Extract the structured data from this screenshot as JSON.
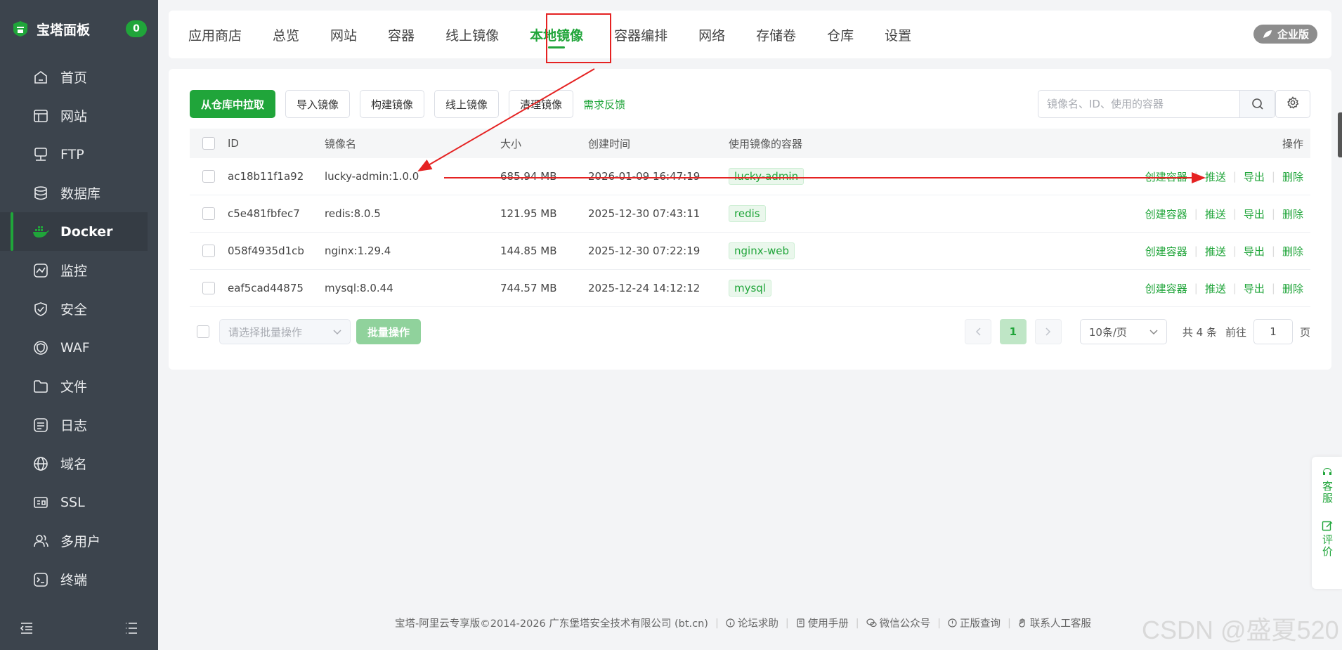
{
  "sidebar": {
    "brand": "宝塔面板",
    "badge": "0",
    "items": [
      {
        "label": "首页",
        "icon": "home-icon"
      },
      {
        "label": "网站",
        "icon": "website-icon"
      },
      {
        "label": "FTP",
        "icon": "ftp-icon"
      },
      {
        "label": "数据库",
        "icon": "database-icon"
      },
      {
        "label": "Docker",
        "icon": "docker-icon",
        "active": true
      },
      {
        "label": "监控",
        "icon": "monitor-icon"
      },
      {
        "label": "安全",
        "icon": "shield-icon"
      },
      {
        "label": "WAF",
        "icon": "waf-icon"
      },
      {
        "label": "文件",
        "icon": "folder-icon"
      },
      {
        "label": "日志",
        "icon": "log-icon"
      },
      {
        "label": "域名",
        "icon": "globe-icon"
      },
      {
        "label": "SSL",
        "icon": "ssl-icon"
      },
      {
        "label": "多用户",
        "icon": "users-icon"
      },
      {
        "label": "终端",
        "icon": "terminal-icon"
      }
    ]
  },
  "topbar": {
    "tabs": [
      "应用商店",
      "总览",
      "网站",
      "容器",
      "线上镜像",
      "本地镜像",
      "容器编排",
      "网络",
      "存储卷",
      "仓库",
      "设置"
    ],
    "active_tab": "本地镜像",
    "enterprise": "企业版"
  },
  "toolbar": {
    "pull": "从仓库中拉取",
    "import": "导入镜像",
    "build": "构建镜像",
    "online": "线上镜像",
    "clean": "清理镜像",
    "feedback": "需求反馈",
    "search_placeholder": "镜像名、ID、使用的容器"
  },
  "table": {
    "headers": {
      "id": "ID",
      "name": "镜像名",
      "size": "大小",
      "time": "创建时间",
      "containers": "使用镜像的容器",
      "ops": "操作"
    },
    "rows": [
      {
        "id": "ac18b11f1a92",
        "name": "lucky-admin:1.0.0",
        "size": "685.94 MB",
        "time": "2026-01-09 16:47:19",
        "container": "lucky-admin"
      },
      {
        "id": "c5e481fbfec7",
        "name": "redis:8.0.5",
        "size": "121.95 MB",
        "time": "2025-12-30 07:43:11",
        "container": "redis"
      },
      {
        "id": "058f4935d1cb",
        "name": "nginx:1.29.4",
        "size": "144.85 MB",
        "time": "2025-12-30 07:22:19",
        "container": "nginx-web"
      },
      {
        "id": "eaf5cad44875",
        "name": "mysql:8.0.44",
        "size": "744.57 MB",
        "time": "2025-12-24 14:12:12",
        "container": "mysql"
      }
    ],
    "ops": {
      "create": "创建容器",
      "push": "推送",
      "export": "导出",
      "delete": "删除"
    }
  },
  "batch": {
    "placeholder": "请选择批量操作",
    "button": "批量操作"
  },
  "pager": {
    "current": "1",
    "per_page": "10条/页",
    "total": "共 4 条",
    "goto": "前往",
    "goto_value": "1",
    "page_unit": "页"
  },
  "float_tools": {
    "service": "客服",
    "rate": "评价"
  },
  "footer": {
    "copyright": "宝塔-阿里云专享版©2014-2026 广东堡塔安全技术有限公司 (bt.cn)",
    "links": [
      "论坛求助",
      "使用手册",
      "微信公众号",
      "正版查询",
      "联系人工客服"
    ]
  },
  "watermark": "CSDN @盛夏520",
  "colors": {
    "accent": "#20a53a",
    "sidebar": "#3c444d",
    "annotation": "#e52222"
  }
}
